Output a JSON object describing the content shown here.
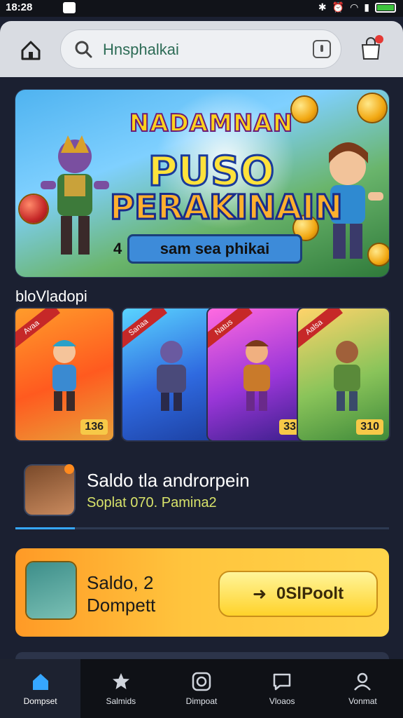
{
  "status_bar": {
    "time": "18:28"
  },
  "header": {
    "search_query": "Hnsphalkai"
  },
  "banner": {
    "line1": "NADAMNAN",
    "line2": "PUSO",
    "line3": "PERAKINAIN",
    "ribbon_number": "4",
    "ribbon_text": "sam sea phikai"
  },
  "section": {
    "label": "bloVladopi"
  },
  "games": [
    {
      "tag": "Avaa",
      "price": "136"
    },
    {
      "tag": "Sanaa",
      "price": ""
    },
    {
      "tag": "Natus",
      "price": "33"
    },
    {
      "tag": "Aalsa",
      "price": "310"
    }
  ],
  "profile": {
    "title": "Saldo tla androrpein",
    "subtitle": "Soplat 070. Pamina2",
    "progress": 0.16
  },
  "wallet": {
    "label1": "Saldo, 2",
    "label2": "Dompett",
    "button_label": "0SlPoolt"
  },
  "bottom_nav": [
    {
      "label": "Dompset",
      "icon": "home-icon"
    },
    {
      "label": "Salmids",
      "icon": "star-icon"
    },
    {
      "label": "Dimpoat",
      "icon": "circle-icon"
    },
    {
      "label": "Vloaos",
      "icon": "chat-icon"
    },
    {
      "label": "Vonmat",
      "icon": "user-icon"
    }
  ],
  "colors": {
    "accent": "#36a7ff",
    "wallet_gradient_start": "#ff9a26",
    "wallet_gradient_end": "#ffd44a",
    "background": "#1b2031"
  }
}
